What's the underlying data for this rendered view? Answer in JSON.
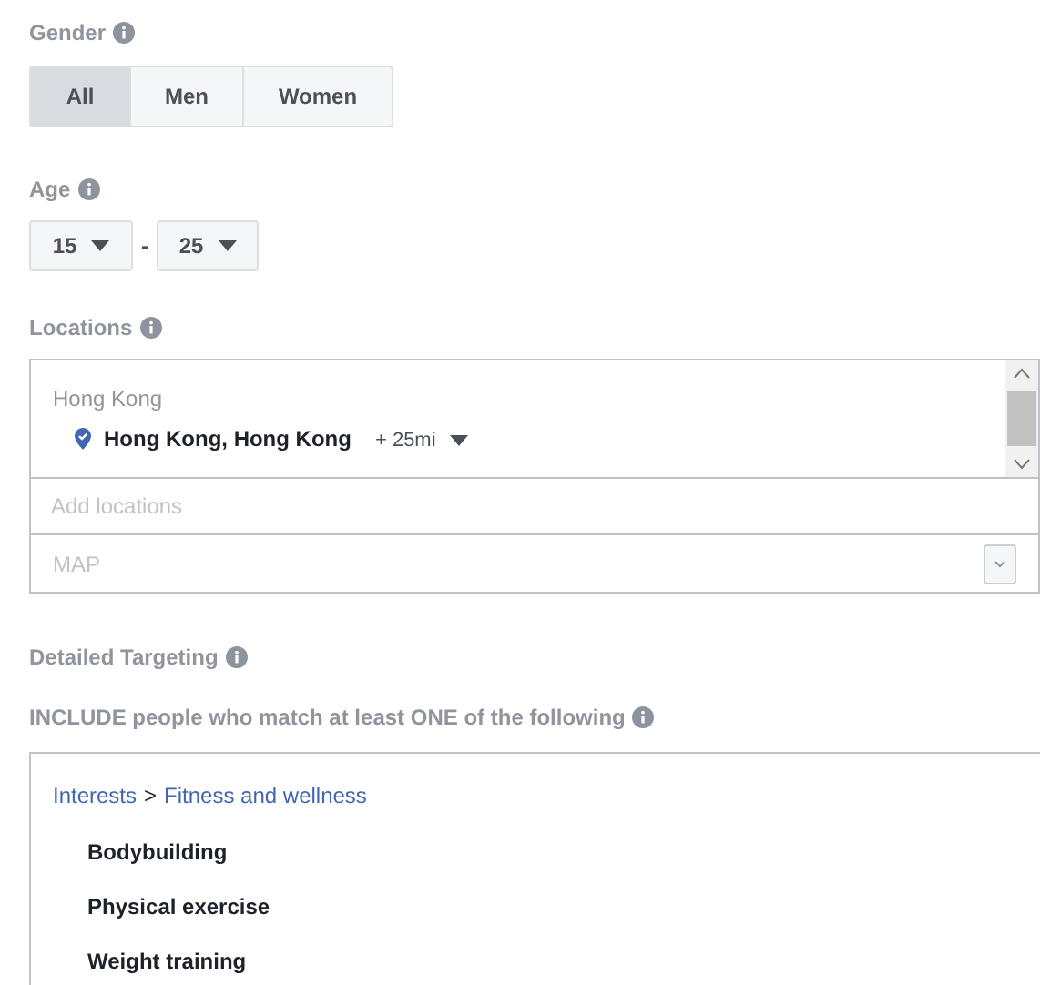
{
  "gender": {
    "label": "Gender",
    "options": [
      {
        "label": "All",
        "selected": true
      },
      {
        "label": "Men",
        "selected": false
      },
      {
        "label": "Women",
        "selected": false
      }
    ]
  },
  "age": {
    "label": "Age",
    "min": "15",
    "separator": "-",
    "max": "25"
  },
  "locations": {
    "label": "Locations",
    "group": "Hong Kong",
    "items": [
      {
        "name": "Hong Kong, Hong Kong",
        "radius": "+ 25mi"
      }
    ],
    "search": {
      "placeholder": "Add locations"
    },
    "map": {
      "label": "MAP"
    }
  },
  "detailed_targeting": {
    "label": "Detailed Targeting",
    "include_label": "INCLUDE people who match at least ONE of the following",
    "breadcrumb": [
      "Interests",
      "Fitness and wellness"
    ],
    "breadcrumb_separator": ">",
    "items": [
      "Bodybuilding",
      "Physical exercise",
      "Weight training"
    ]
  }
}
